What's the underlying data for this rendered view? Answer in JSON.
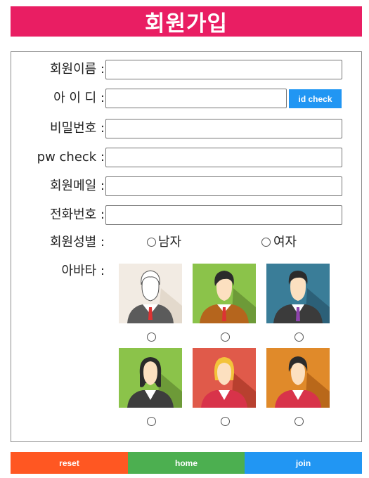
{
  "title": "회원가입",
  "fields": {
    "name_label": "회원이름 :",
    "id_label": "아 이 디 :",
    "password_label": "비밀번호 :",
    "pw_check_label": "pw check :",
    "email_label": "회원메일 :",
    "phone_label": "전화번호 :",
    "gender_label": "회원성별 :",
    "avatar_label": "아바타 :"
  },
  "id_check_button": "id check",
  "gender": {
    "male": "남자",
    "female": "여자"
  },
  "avatars": [
    {
      "name": "avatar-outline-man-icon",
      "bg": "#f2ebe3"
    },
    {
      "name": "avatar-green-man-icon",
      "bg": "#8bc34a"
    },
    {
      "name": "avatar-teal-man-icon",
      "bg": "#3a7d98"
    },
    {
      "name": "avatar-green-woman-icon",
      "bg": "#8bc34a"
    },
    {
      "name": "avatar-red-blonde-woman-icon",
      "bg": "#e05a4a"
    },
    {
      "name": "avatar-orange-woman-icon",
      "bg": "#e08a2a"
    }
  ],
  "footer": {
    "reset": "reset",
    "home": "home",
    "join": "join"
  },
  "colors": {
    "title_bg": "#e91e63",
    "reset": "#ff5722",
    "home": "#4caf50",
    "join": "#2196f3",
    "id_check": "#2196f3"
  }
}
